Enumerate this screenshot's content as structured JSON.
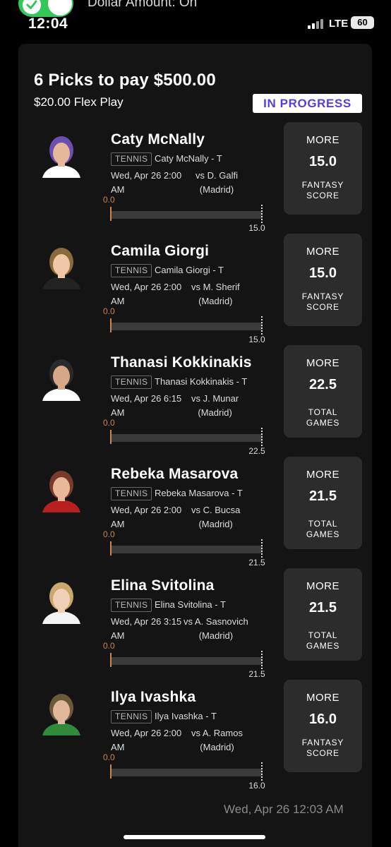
{
  "status_bar": {
    "time": "12:04",
    "network": "LTE",
    "battery": "60",
    "notice": "Dollar Amount: On"
  },
  "entry": {
    "title": "6 Picks to pay $500.00",
    "subtitle": "$20.00 Flex Play",
    "status": "IN PROGRESS"
  },
  "picks": [
    {
      "name": "Caty McNally",
      "sport": "TENNIS",
      "desc": "Caty McNally - T",
      "date": "Wed, Apr 26 2:00",
      "ampm": "AM",
      "opp": "vs D. Galfi",
      "venue": "(Madrid)",
      "current": "0.0",
      "line": "15.0",
      "direction": "MORE",
      "stat": "FANTASY SCORE",
      "progress": 0.0
    },
    {
      "name": "Camila Giorgi",
      "sport": "TENNIS",
      "desc": "Camila Giorgi - T",
      "date": "Wed, Apr 26 2:00",
      "ampm": "AM",
      "opp": "vs M. Sherif",
      "venue": "(Madrid)",
      "current": "0.0",
      "line": "15.0",
      "direction": "MORE",
      "stat": "FANTASY SCORE",
      "progress": 0.0
    },
    {
      "name": "Thanasi Kokkinakis",
      "sport": "TENNIS",
      "desc": "Thanasi Kokkinakis - T",
      "date": "Wed, Apr 26 6:15",
      "ampm": "AM",
      "opp": "vs J. Munar",
      "venue": "(Madrid)",
      "current": "0.0",
      "line": "22.5",
      "direction": "MORE",
      "stat": "TOTAL GAMES",
      "progress": 0.0
    },
    {
      "name": "Rebeka Masarova",
      "sport": "TENNIS",
      "desc": "Rebeka Masarova - T",
      "date": "Wed, Apr 26 2:00",
      "ampm": "AM",
      "opp": "vs C. Bucsa",
      "venue": "(Madrid)",
      "current": "0.0",
      "line": "21.5",
      "direction": "MORE",
      "stat": "TOTAL GAMES",
      "progress": 0.0
    },
    {
      "name": "Elina Svitolina",
      "sport": "TENNIS",
      "desc": "Elina Svitolina - T",
      "date": "Wed, Apr 26 3:15",
      "ampm": "AM",
      "opp": "vs A. Sasnovich",
      "venue": "(Madrid)",
      "current": "0.0",
      "line": "21.5",
      "direction": "MORE",
      "stat": "TOTAL GAMES",
      "progress": 0.0
    },
    {
      "name": "Ilya Ivashka",
      "sport": "TENNIS",
      "desc": "Ilya Ivashka - T",
      "date": "Wed, Apr 26 2:00",
      "ampm": "AM",
      "opp": "vs A. Ramos",
      "venue": "(Madrid)",
      "current": "0.0",
      "line": "16.0",
      "direction": "MORE",
      "stat": "FANTASY SCORE",
      "progress": 0.0
    }
  ],
  "footer": {
    "timestamp": "Wed, Apr 26 12:03 AM"
  }
}
